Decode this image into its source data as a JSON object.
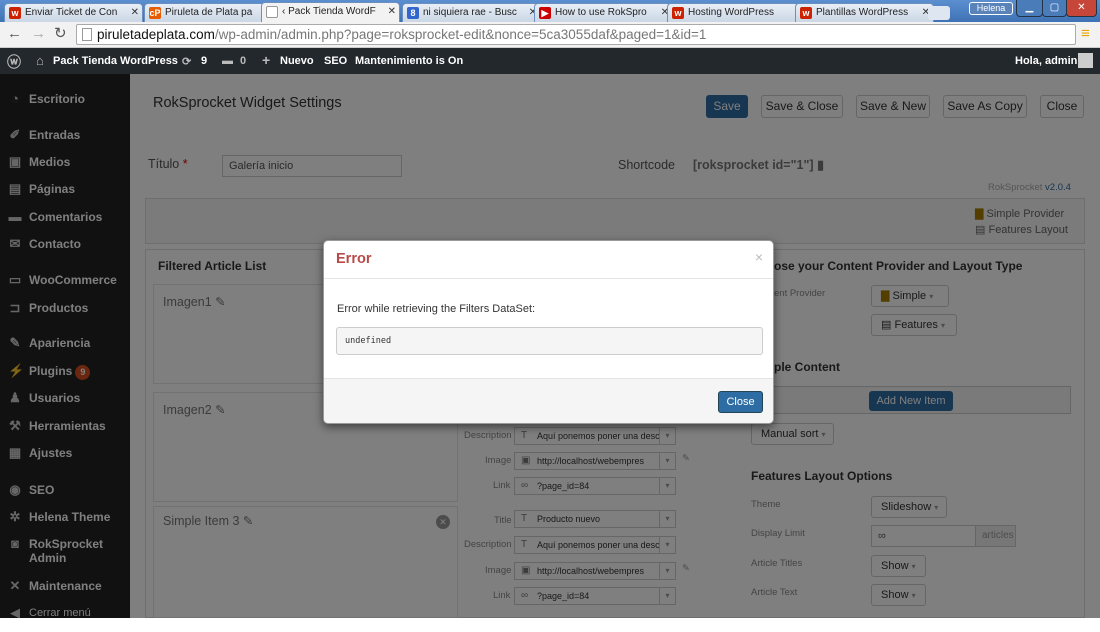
{
  "browser": {
    "tabs": [
      {
        "label": "Enviar Ticket de Con",
        "favicon": "w",
        "color": "#cc2200"
      },
      {
        "label": "Piruleta de Plata pa",
        "favicon": "cP",
        "color": "#e65c00"
      },
      {
        "label": "‹ Pack Tienda WordF",
        "favicon": "□",
        "color": "#888888"
      },
      {
        "label": "ni siquiera rae - Busc",
        "favicon": "8",
        "color": "#3366cc"
      },
      {
        "label": "How to use RokSpro",
        "favicon": "▶",
        "color": "#cc0000"
      },
      {
        "label": "Hosting WordPress",
        "favicon": "w",
        "color": "#cc2200"
      },
      {
        "label": "Plantillas WordPress",
        "favicon": "w",
        "color": "#cc2200"
      }
    ],
    "user": "Helena",
    "url_host": "piruletadeplata.com",
    "url_path": "/wp-admin/admin.php?page=roksprocket-edit&nonce=5ca3055daf&paged=1&id=1"
  },
  "adminbar": {
    "site": "Pack Tienda WordPress",
    "updates": "9",
    "comments": "0",
    "new": "Nuevo",
    "seo": "SEO",
    "maintenance": "Mantenimiento is On",
    "greeting": "Hola, admin"
  },
  "sidebar": {
    "items": [
      {
        "label": "Escritorio",
        "icon": "dashboard-icon",
        "glyph": "◔"
      },
      {
        "label": "Entradas",
        "icon": "pin-icon",
        "glyph": "✐"
      },
      {
        "label": "Medios",
        "icon": "media-icon",
        "glyph": "▣"
      },
      {
        "label": "Páginas",
        "icon": "page-icon",
        "glyph": "▤"
      },
      {
        "label": "Comentarios",
        "icon": "comment-icon",
        "glyph": "▬"
      },
      {
        "label": "Contacto",
        "icon": "mail-icon",
        "glyph": "✉"
      },
      {
        "label": "WooCommerce",
        "icon": "woo-icon",
        "glyph": "▭"
      },
      {
        "label": "Productos",
        "icon": "cart-icon",
        "glyph": "⊐"
      },
      {
        "label": "Apariencia",
        "icon": "brush-icon",
        "glyph": "✎"
      },
      {
        "label": "Plugins",
        "icon": "plugin-icon",
        "glyph": "⚡",
        "badge": "9"
      },
      {
        "label": "Usuarios",
        "icon": "user-icon",
        "glyph": "♟"
      },
      {
        "label": "Herramientas",
        "icon": "wrench-icon",
        "glyph": "⚒"
      },
      {
        "label": "Ajustes",
        "icon": "settings-icon",
        "glyph": "▦"
      },
      {
        "label": "SEO",
        "icon": "seo-icon",
        "glyph": "◉"
      },
      {
        "label": "Helena Theme",
        "icon": "gear-icon",
        "glyph": "✲"
      },
      {
        "label": "RokSprocket Admin",
        "icon": "rocket-icon",
        "glyph": "◙"
      },
      {
        "label": "Maintenance",
        "icon": "tools-icon",
        "glyph": "✕"
      },
      {
        "label": "Cerrar menú",
        "icon": "collapse-icon",
        "glyph": "◀"
      }
    ]
  },
  "main": {
    "title": "RokSprocket Widget Settings",
    "buttons": {
      "save": "Save",
      "save_close": "Save & Close",
      "save_new": "Save & New",
      "save_copy": "Save As Copy",
      "close": "Close"
    },
    "titulo_label": "Título",
    "titulo_value": "Galería inicio",
    "shortcode_label": "Shortcode",
    "shortcode_value": "[roksprocket id=\"1\"]",
    "version_prefix": "RokSprocket",
    "version": "v2.0.4",
    "provider_summary": "Simple Provider",
    "layout_summary": "Features Layout",
    "filtered_heading": "Filtered Article List",
    "items": [
      {
        "name": "Imagen1"
      },
      {
        "name": "Imagen2"
      },
      {
        "name": "Simple Item 3"
      }
    ],
    "item2_fields": {
      "description_label": "Description",
      "description_value": "Aquí ponemos poner una desc",
      "image_label": "Image",
      "image_value": "http://localhost/webempres",
      "link_label": "Link",
      "link_value": "?page_id=84"
    },
    "item3_fields": {
      "title_label": "Title",
      "title_value": "Producto nuevo",
      "description_label": "Description",
      "description_value": "Aquí ponemos poner una desc",
      "image_label": "Image",
      "image_value": "http://localhost/webempres",
      "link_label": "Link",
      "link_value": "?page_id=84"
    },
    "right": {
      "choose_heading": "ose your Content Provider and Layout Type",
      "content_provider_label": "ent Provider",
      "provider_value": "Simple",
      "layout_value": "Features",
      "simple_content_heading": "ple Content",
      "add_item": "Add New Item",
      "sort": "Manual sort",
      "features_heading": "Features Layout Options",
      "theme_label": "Theme",
      "theme_value": "Slideshow",
      "display_limit_label": "Display Limit",
      "display_limit_value": "∞",
      "display_limit_unit": "articles",
      "article_titles_label": "Article Titles",
      "article_titles_value": "Show",
      "article_text_label": "Article Text",
      "article_text_value": "Show"
    }
  },
  "modal": {
    "title": "Error",
    "close_x": "×",
    "message": "Error while retrieving the Filters DataSet:",
    "detail": "undefined",
    "close_button": "Close"
  },
  "colors": {
    "primary": "#2e6da4",
    "error": "#b94a48",
    "adminbar": "#23282d",
    "sidebar": "#222222",
    "badge": "#d54e21"
  }
}
